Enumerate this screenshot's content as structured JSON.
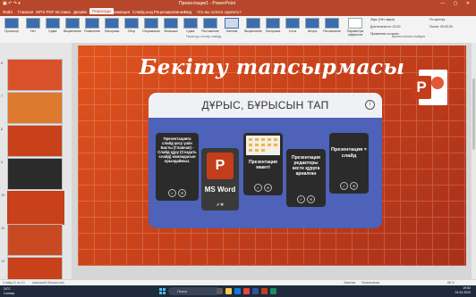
{
  "window": {
    "title": "Презентация1 - PowerPoint",
    "controls": "— ▢ ✕",
    "quick_access": "▣ ↶ ↷ ▾"
  },
  "tabs": [
    {
      "label": "Файл"
    },
    {
      "label": "Главная"
    },
    {
      "label": "WPS PDF"
    },
    {
      "label": "Вставка"
    },
    {
      "label": "Дизайн"
    },
    {
      "label": "Переходы"
    },
    {
      "label": "Анимация"
    },
    {
      "label": "Слайд-шоу"
    },
    {
      "label": "Рецензирование"
    },
    {
      "label": "Вид"
    },
    {
      "label": "Что вы хотите сделать?"
    }
  ],
  "ribbon": {
    "preview_label": "Просмотр",
    "transitions": [
      "Нет",
      "Сдвиг",
      "Выцветание",
      "Появление",
      "Панорама",
      "Сбор",
      "Открывание",
      "Вспышка",
      "Сдвиг",
      "Растяжение",
      "Наплыв",
      "Выцветание",
      "Панорама",
      "Соты",
      "Штора",
      "Рассыпание",
      "Проявление",
      "Открытие",
      "Отражение",
      "Вихрь"
    ],
    "effects_label": "Параметры эффектов",
    "group_transitions": "Переход к этому слайду",
    "group_timing": "Время показа слайдов",
    "sound_label": "Звук: [Нет звука]",
    "duration_label": "Длительность: 02.00",
    "apply_all_label": "Применить ко всем",
    "on_click_label": "По щелчку",
    "after_label": "После: 00:00,00"
  },
  "thumbnails": [
    {
      "num": "6",
      "color": "#d9512a"
    },
    {
      "num": "7",
      "color": "#dd7a2f"
    },
    {
      "num": "8",
      "color": "#c8411a"
    },
    {
      "num": "9",
      "color": "#2b2b2b"
    },
    {
      "num": "10",
      "color": "#c8411a"
    },
    {
      "num": "11",
      "color": "#c94a22"
    },
    {
      "num": "12",
      "color": "#c8411a"
    }
  ],
  "slide": {
    "title": "Бекіту тапсырмасы",
    "quiz_title": "ДҰРЫС, БҰРЫСЫН ТАП",
    "info_icon": "i",
    "cards": [
      {
        "text": "Презентацияға слайд қосу үшін Басты (Главная) - Слайд құру (Создать слайд) командасын орындаймыз."
      },
      {
        "text": "MS Word"
      },
      {
        "text": "Презентация макеті"
      },
      {
        "text": "Презентация редакторы кесте құруға арналған"
      },
      {
        "text": "Презентация = слайд"
      }
    ],
    "check_icon": "✓",
    "cross_icon": "✕"
  },
  "status": {
    "slide_info": "Слайд 11 из 13",
    "language": "казахский (Казахстан)",
    "notes": "Заметки",
    "comments": "Примечания",
    "zoom": "88 %"
  },
  "taskbar": {
    "weather_temp": "24°C",
    "weather_desc": "Солнце",
    "search_placeholder": "Поиск",
    "time": "19:52",
    "date": "24.02.2024"
  }
}
